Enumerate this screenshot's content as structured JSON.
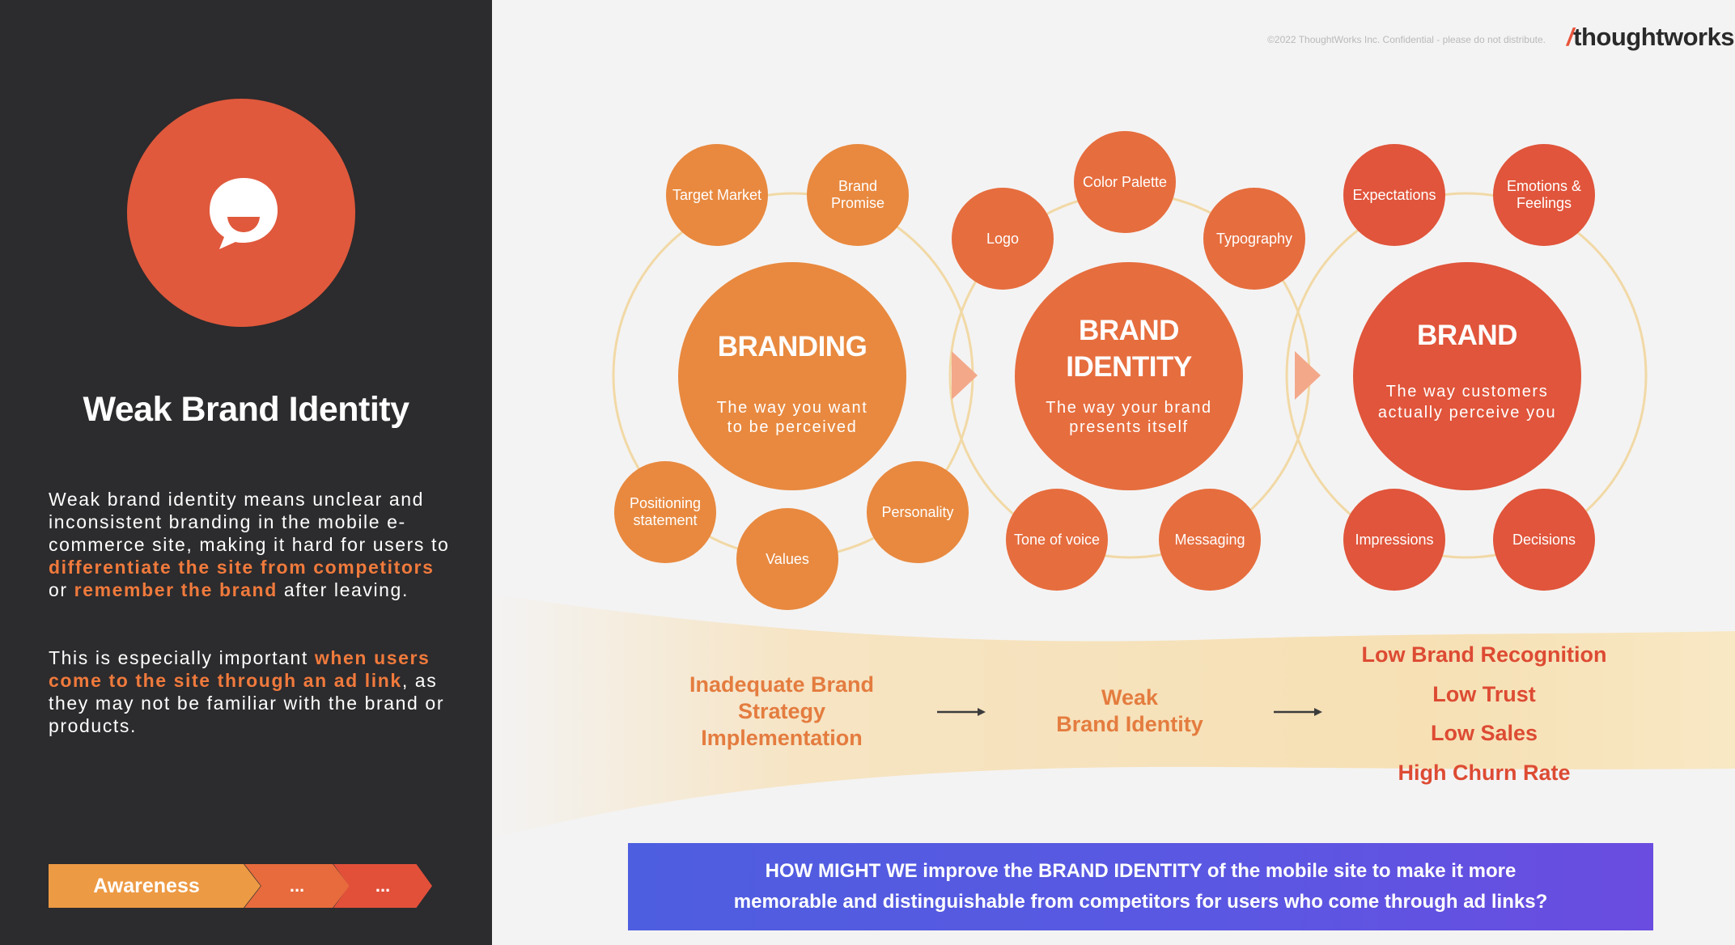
{
  "left": {
    "title": "Weak Brand Identity",
    "icon": "chat-bubble-icon",
    "para1": [
      {
        "t": "Weak brand identity means unclear and inconsistent branding in the mobile e-commerce site, making it hard for users to ",
        "hl": false
      },
      {
        "t": "differentiate the site from competitors",
        "hl": true
      },
      {
        "t": " or ",
        "hl": false
      },
      {
        "t": "remember the brand",
        "hl": true
      },
      {
        "t": " after leaving.",
        "hl": false
      }
    ],
    "para2": [
      {
        "t": "This is especially important ",
        "hl": false
      },
      {
        "t": "when users come to the site through an ad link",
        "hl": true
      },
      {
        "t": ", as they may not be familiar with the brand or products.",
        "hl": false
      }
    ],
    "stages": [
      "Awareness",
      "...",
      "..."
    ]
  },
  "header": {
    "copyright": "©2022 ThoughtWorks Inc. Confidential - please do not distribute.",
    "logo_slash": "/",
    "logo_text": "thoughtworks"
  },
  "diagram": {
    "branding": {
      "title1": "BRANDING",
      "sub1": "The way you want",
      "sub2": "to be perceived",
      "satellites": [
        "Target Market",
        "Brand Promise",
        "Positioning statement",
        "Values",
        "Personality"
      ]
    },
    "identity": {
      "title1": "BRAND",
      "title2": "IDENTITY",
      "sub1": "The way your brand",
      "sub2": "presents itself",
      "satellites": [
        "Logo",
        "Color Palette",
        "Typography",
        "Tone of voice",
        "Messaging"
      ]
    },
    "brand": {
      "title1": "BRAND",
      "sub1": "The way customers",
      "sub2": "actually perceive you",
      "satellites": [
        "Expectations",
        "Emotions & Feelings",
        "Impressions",
        "Decisions"
      ]
    },
    "colors": {
      "orange": "#e8893f",
      "mid": "#e66d3e",
      "red": "#e0553b"
    }
  },
  "flow": {
    "cause_lines": [
      "Inadequate Brand",
      "Strategy",
      "Implementation"
    ],
    "middle_lines": [
      "Weak",
      "Brand Identity"
    ],
    "outcomes": [
      "Low Brand Recognition",
      "Low Trust",
      "Low Sales",
      "High Churn Rate"
    ]
  },
  "hmw": {
    "line1": "HOW MIGHT WE improve the BRAND IDENTITY of the mobile site to make it more",
    "line2": "memorable and distinguishable from competitors for users who come through ad links?"
  }
}
